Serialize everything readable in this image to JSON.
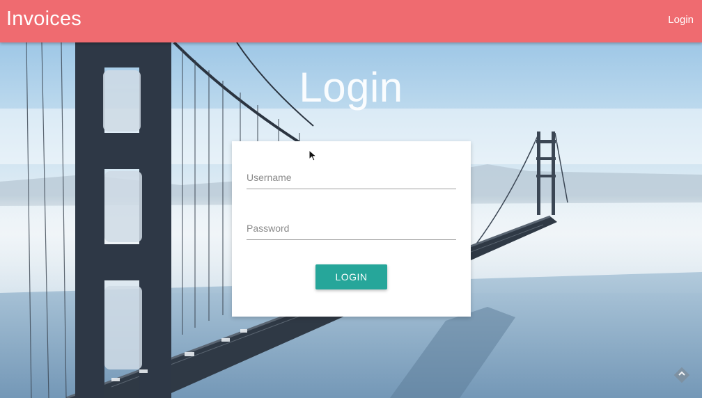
{
  "header": {
    "title": "Invoices",
    "nav_login_label": "Login",
    "background_color": "#ef6b70"
  },
  "main": {
    "heading": "Login"
  },
  "login_form": {
    "username_placeholder": "Username",
    "username_value": "",
    "password_placeholder": "Password",
    "password_value": "",
    "submit_label": "LOGIN",
    "submit_color": "#26a69a"
  },
  "background": {
    "scene": "golden-gate-bridge-fog"
  },
  "icons": {
    "cursor": "mouse-pointer-icon",
    "corner": "diamond-logo-icon"
  }
}
